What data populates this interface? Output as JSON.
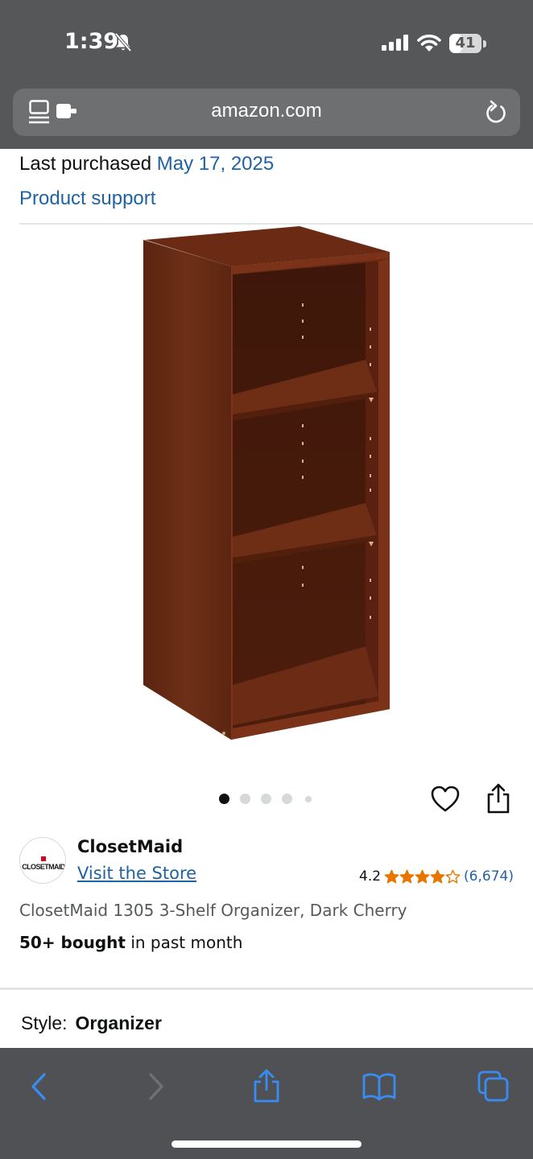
{
  "status_bar": {
    "time": "1:39",
    "battery_level": "41",
    "icons": [
      "bell-slash-icon",
      "cellular-signal-icon",
      "wifi-icon",
      "battery-icon"
    ]
  },
  "browser": {
    "url": "amazon.com",
    "icons": [
      "tabs-icon",
      "reload-icon"
    ]
  },
  "purchase": {
    "label": "Last purchased",
    "date": "May 17, 2025",
    "support_link": "Product support"
  },
  "gallery": {
    "image_count": 5,
    "active_index": 0
  },
  "brand": {
    "logo_text": "CLOSETMAID",
    "name": "ClosetMaid",
    "store_link": "Visit the Store"
  },
  "rating": {
    "value": "4.2",
    "stars": 4.2,
    "count": "(6,674)",
    "star_color": "#e77600"
  },
  "product": {
    "title": "ClosetMaid 1305 3-Shelf Organizer, Dark Cherry",
    "bought_strong": "50+ bought",
    "bought_rest": "in past month"
  },
  "style": {
    "label": "Style:",
    "value": "Organizer"
  },
  "toolbar": {
    "items": [
      "back-icon",
      "forward-icon",
      "share-icon",
      "bookmarks-icon",
      "tabs-overview-icon"
    ],
    "accent": "#3a8cf5"
  }
}
